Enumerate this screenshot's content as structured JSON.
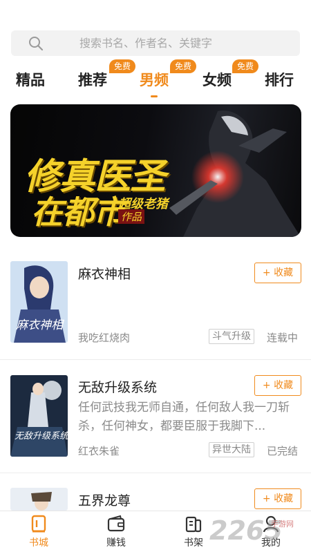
{
  "search": {
    "placeholder": "搜索书名、作者名、关键字",
    "icon": "search-icon"
  },
  "tabs": [
    {
      "label": "精品",
      "badge": null,
      "active": false
    },
    {
      "label": "推荐",
      "badge": "免费",
      "active": false
    },
    {
      "label": "男频",
      "badge": "免费",
      "active": true
    },
    {
      "label": "女频",
      "badge": "免费",
      "active": false
    },
    {
      "label": "排行",
      "badge": null,
      "active": false
    }
  ],
  "banner": {
    "title_line1": "修真医圣",
    "title_line2": "在都市",
    "author": "超级老猪",
    "suffix": "作品"
  },
  "books": [
    {
      "name": "麻衣神相",
      "description": "",
      "author": "我吃红烧肉",
      "tag": "斗气升级",
      "status": "连载中",
      "cover_text": "麻衣神相",
      "fav_label": "+ 收藏"
    },
    {
      "name": "无敌升级系统",
      "description": "任何武技我无师自通，任何敌人我一刀斩杀，任何神女，都要臣服于我脚下...",
      "author": "红衣朱雀",
      "tag": "异世大陆",
      "status": "已完结",
      "cover_text": "无敌升级系统",
      "fav_label": "+ 收藏"
    },
    {
      "name": "五界龙尊",
      "description": "",
      "author": "",
      "tag": "",
      "status": "",
      "cover_text": "",
      "fav_label": "+ 收藏"
    }
  ],
  "bottom_nav": [
    {
      "label": "书城",
      "icon": "bookstore-icon",
      "active": true
    },
    {
      "label": "赚钱",
      "icon": "wallet-icon",
      "active": false
    },
    {
      "label": "书架",
      "icon": "bookshelf-icon",
      "active": false
    },
    {
      "label": "我的",
      "icon": "profile-icon",
      "active": false
    }
  ],
  "watermark": {
    "text": "2265",
    "sub": "手游网"
  },
  "colors": {
    "accent": "#f08a1c",
    "text": "#222222",
    "muted": "#8a8a8a",
    "banner_title": "#f5d22b"
  }
}
